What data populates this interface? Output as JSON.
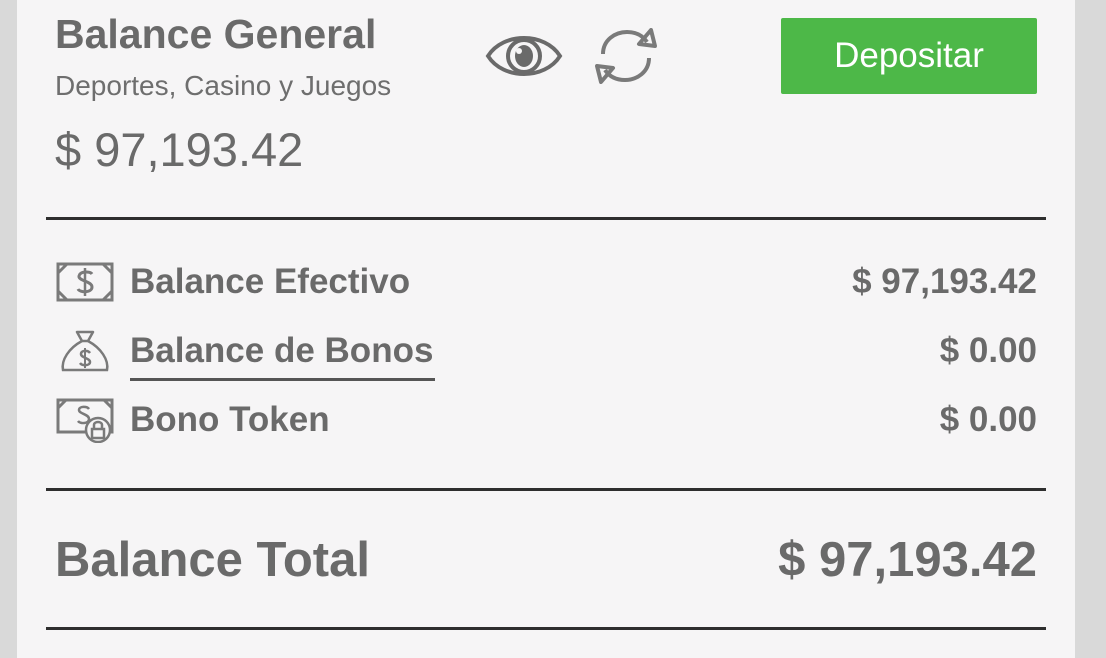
{
  "header": {
    "title": "Balance General",
    "subtitle": "Deportes, Casino y Juegos",
    "amount": "$ 97,193.42",
    "deposit_label": "Depositar",
    "icons": [
      "eye-icon",
      "refresh-icon"
    ]
  },
  "breakdown": {
    "rows": [
      {
        "icon": "cash-bill-icon",
        "label": "Balance Efectivo",
        "amount": "$ 97,193.42"
      },
      {
        "icon": "money-bag-icon",
        "label": "Balance de Bonos",
        "amount": "$ 0.00"
      },
      {
        "icon": "locked-bill-icon",
        "label": "Bono Token",
        "amount": "$ 0.00"
      }
    ]
  },
  "total": {
    "label": "Balance Total",
    "amount": "$ 97,193.42"
  },
  "colors": {
    "accent": "#4db848",
    "text": "#6a6a6a",
    "background": "#f6f5f6",
    "divider": "#2e2e2e"
  }
}
